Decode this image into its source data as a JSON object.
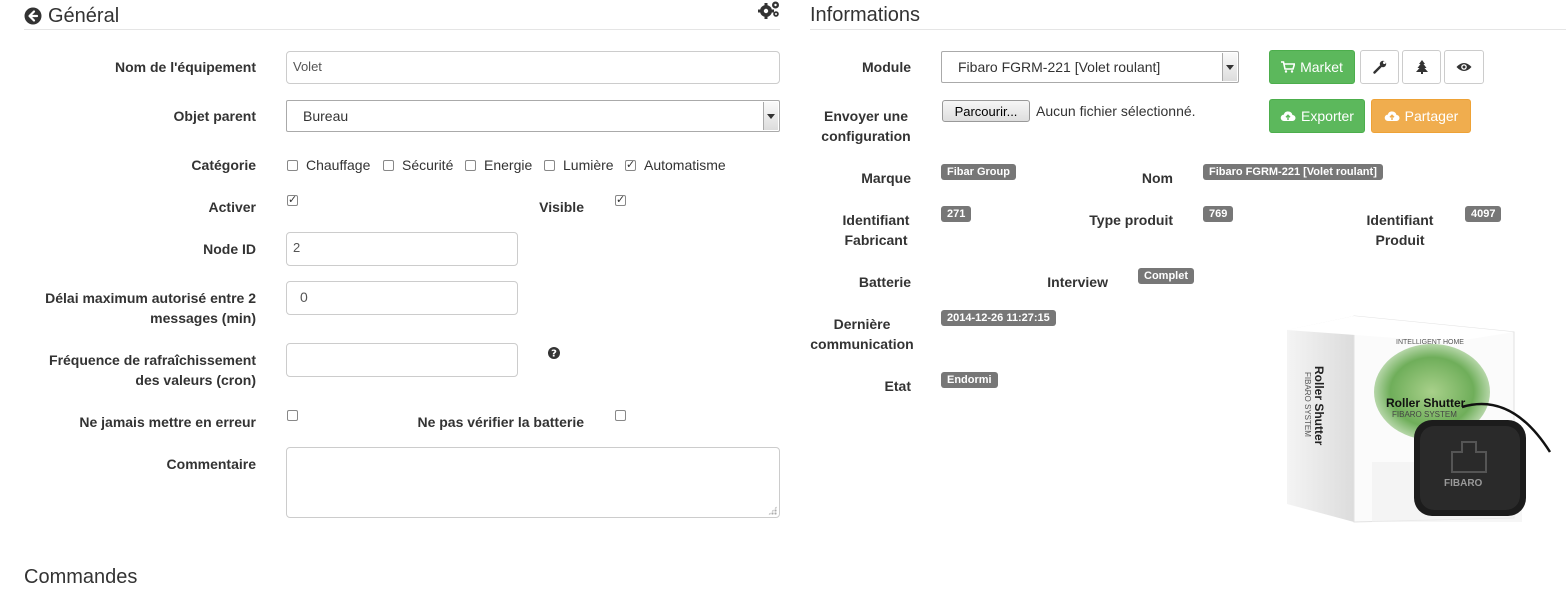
{
  "general": {
    "title": "Général",
    "fields": {
      "name_label": "Nom de l'équipement",
      "name_value": "Volet",
      "parent_label": "Objet parent",
      "parent_value": "Bureau",
      "category_label": "Catégorie",
      "categories": [
        {
          "label": "Chauffage",
          "checked": false
        },
        {
          "label": "Sécurité",
          "checked": false
        },
        {
          "label": "Energie",
          "checked": false
        },
        {
          "label": "Lumière",
          "checked": false
        },
        {
          "label": "Automatisme",
          "checked": true
        }
      ],
      "activate_label": "Activer",
      "activate_checked": true,
      "visible_label": "Visible",
      "visible_checked": true,
      "node_label": "Node ID",
      "node_value": "2",
      "delay_label_1": "Délai maximum autorisé entre 2",
      "delay_label_2": "messages (min)",
      "delay_value": "0",
      "refresh_label_1": "Fréquence de rafraîchissement",
      "refresh_label_2": "des valeurs (cron)",
      "refresh_value": "",
      "never_error_label": "Ne jamais mettre en erreur",
      "never_error_checked": false,
      "no_battery_label": "Ne pas vérifier la batterie",
      "no_battery_checked": false,
      "comment_label": "Commentaire",
      "comment_value": ""
    }
  },
  "info": {
    "title": "Informations",
    "module_label": "Module",
    "module_value": "Fibaro FGRM-221 [Volet roulant]",
    "buttons": {
      "market": "Market",
      "export": "Exporter",
      "share": "Partager"
    },
    "send_config_label_1": "Envoyer une",
    "send_config_label_2": "configuration",
    "file_button": "Parcourir...",
    "file_status": "Aucun fichier sélectionné.",
    "brand_label": "Marque",
    "brand_value": "Fibar Group",
    "name_label": "Nom",
    "name_value": "Fibaro FGRM-221 [Volet roulant]",
    "manufacturer_id_label_1": "Identifiant",
    "manufacturer_id_label_2": "Fabricant",
    "manufacturer_id_value": "271",
    "product_type_label": "Type produit",
    "product_type_value": "769",
    "product_id_label_1": "Identifiant",
    "product_id_label_2": "Produit",
    "product_id_value": "4097",
    "battery_label": "Batterie",
    "interview_label": "Interview",
    "interview_value": "Complet",
    "last_comm_label_1": "Dernière",
    "last_comm_label_2": "communication",
    "last_comm_value": "2014-12-26 11:27:15",
    "state_label": "Etat",
    "state_value": "Endormi",
    "product_image": {
      "side_text_1": "Roller Shutter",
      "side_text_2": "FIBARO SYSTEM",
      "front_top": "INTELLIGENT HOME",
      "front_title": "Roller Shutter",
      "front_sub": "FIBARO SYSTEM",
      "device_brand": "FIBARO"
    }
  },
  "commands": {
    "title": "Commandes"
  },
  "icons": {
    "back": "circle-arrow-left-icon",
    "settings": "gears-icon",
    "help": "question-circle-icon",
    "cart": "shopping-cart-icon",
    "wrench": "wrench-icon",
    "tree": "tree-icon",
    "eye": "eye-icon",
    "cloud_up": "cloud-upload-icon"
  },
  "colors": {
    "success": "#5cb85c",
    "warning": "#f0ad4e",
    "badge": "#777777"
  }
}
